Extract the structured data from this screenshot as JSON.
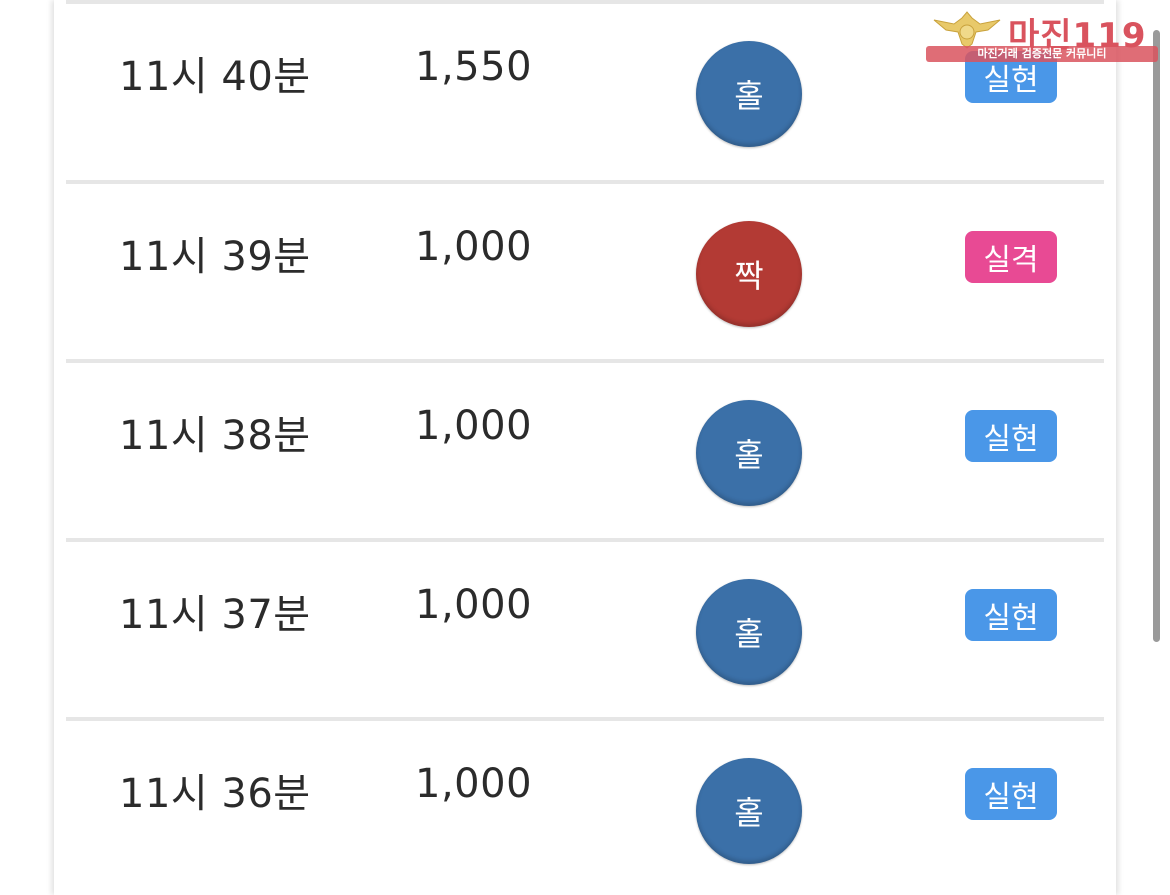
{
  "rows": [
    {
      "time": "11시 40분",
      "amount": "1,550",
      "pick": "홀",
      "result": "실현",
      "pick_type": "odd",
      "result_type": "hit"
    },
    {
      "time": "11시 39분",
      "amount": "1,000",
      "pick": "짝",
      "result": "실격",
      "pick_type": "even",
      "result_type": "miss"
    },
    {
      "time": "11시 38분",
      "amount": "1,000",
      "pick": "홀",
      "result": "실현",
      "pick_type": "odd",
      "result_type": "hit"
    },
    {
      "time": "11시 37분",
      "amount": "1,000",
      "pick": "홀",
      "result": "실현",
      "pick_type": "odd",
      "result_type": "hit"
    },
    {
      "time": "11시 36분",
      "amount": "1,000",
      "pick": "홀",
      "result": "실현",
      "pick_type": "odd",
      "result_type": "hit"
    }
  ],
  "watermark": {
    "title": "마진119",
    "subtitle": "마진거래 검증전문 커뮤니티"
  },
  "colors": {
    "odd_ball": "#3b70a8",
    "even_ball": "#b33a34",
    "hit_badge": "#4a97e8",
    "miss_badge": "#e84a94"
  }
}
